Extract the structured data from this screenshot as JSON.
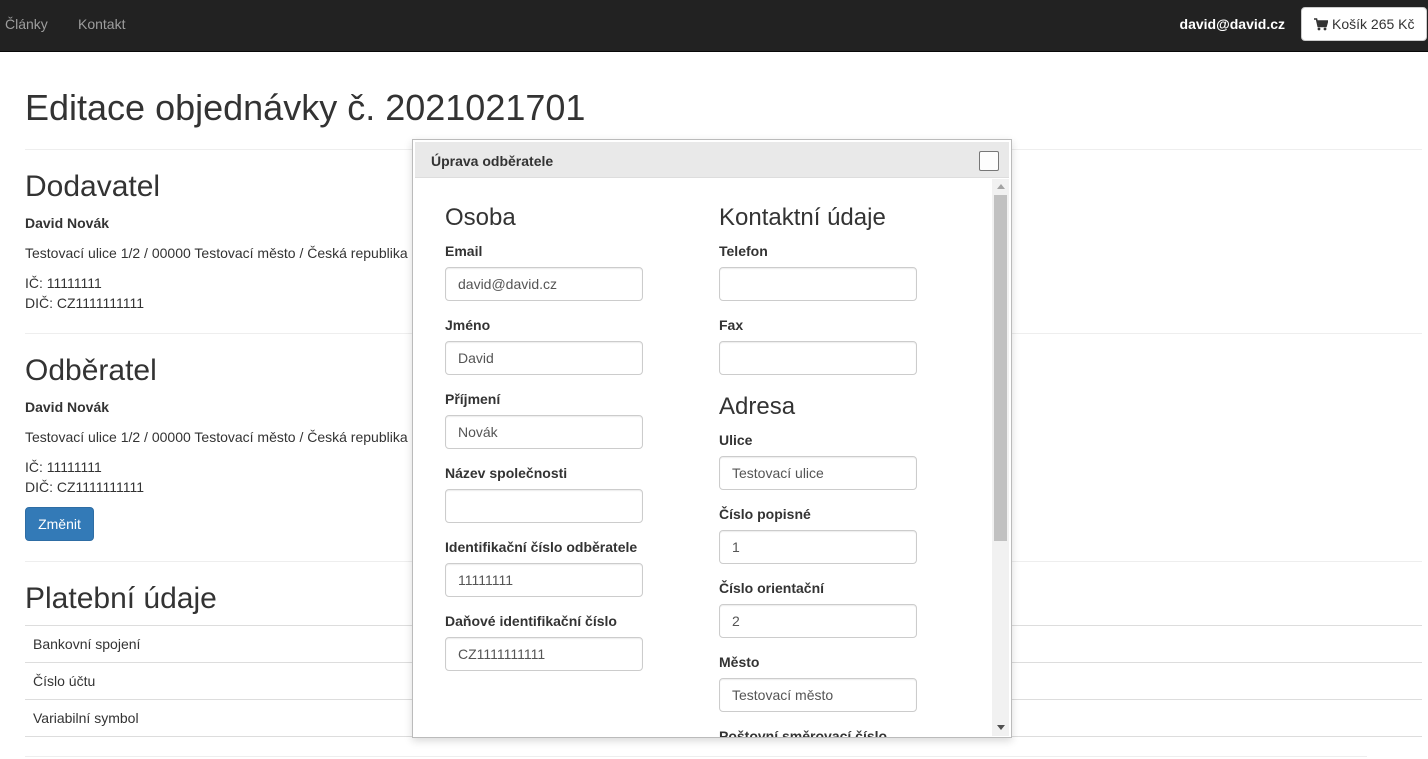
{
  "navbar": {
    "links": [
      "Články",
      "Kontakt"
    ],
    "user": "david@david.cz",
    "cart_label": "Košík 265 Kč"
  },
  "page": {
    "title": "Editace objednávky č. 2021021701"
  },
  "supplier": {
    "heading": "Dodavatel",
    "name": "David Novák",
    "address": "Testovací ulice 1/2 / 00000 Testovací město / Česká republika",
    "ic": "IČ: 11111111",
    "dic": "DIČ: CZ1111111111"
  },
  "customer": {
    "heading": "Odběratel",
    "name": "David Novák",
    "address": "Testovací ulice 1/2 / 00000 Testovací město / Česká republika",
    "ic": "IČ: 11111111",
    "dic": "DIČ: CZ1111111111",
    "change_button": "Změnit"
  },
  "payment": {
    "heading": "Platební údaje",
    "rows": [
      "Bankovní spojení",
      "Číslo účtu",
      "Variabilní symbol"
    ]
  },
  "dialog": {
    "title": "Úprava odběratele",
    "person": {
      "heading": "Osoba",
      "fields": [
        {
          "label": "Email",
          "value": "david@david.cz"
        },
        {
          "label": "Jméno",
          "value": "David"
        },
        {
          "label": "Příjmení",
          "value": "Novák"
        },
        {
          "label": "Název společnosti",
          "value": ""
        },
        {
          "label": "Identifikační číslo odběratele",
          "value": "11111111"
        },
        {
          "label": "Daňové identifikační číslo",
          "value": "CZ1111111111"
        }
      ]
    },
    "contact": {
      "heading": "Kontaktní údaje",
      "fields": [
        {
          "label": "Telefon",
          "value": ""
        },
        {
          "label": "Fax",
          "value": ""
        }
      ]
    },
    "address": {
      "heading": "Adresa",
      "fields": [
        {
          "label": "Ulice",
          "value": "Testovací ulice"
        },
        {
          "label": "Číslo popisné",
          "value": "1"
        },
        {
          "label": "Číslo orientační",
          "value": "2"
        },
        {
          "label": "Město",
          "value": "Testovací město"
        },
        {
          "label": "Poštovní směrovací číslo",
          "value": ""
        }
      ]
    }
  }
}
